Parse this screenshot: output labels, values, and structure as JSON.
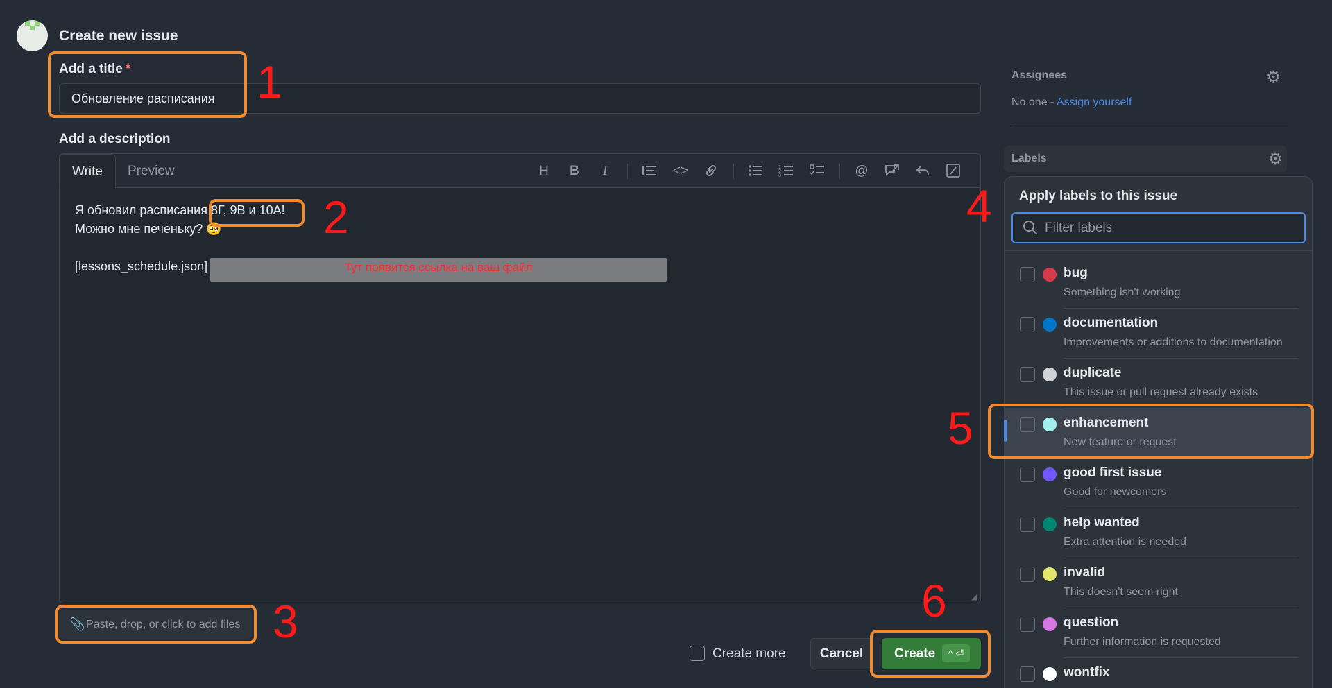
{
  "header": {
    "page_title": "Create new issue"
  },
  "title_field": {
    "label": "Add a title",
    "required_mark": "*",
    "value": "Обновление расписания"
  },
  "description": {
    "label": "Add a description",
    "tabs": {
      "write": "Write",
      "preview": "Preview"
    },
    "toolbar": [
      "heading-icon",
      "bold-icon",
      "italic-icon",
      "quote-icon",
      "code-icon",
      "link-icon",
      "unordered-list-icon",
      "ordered-list-icon",
      "task-list-icon",
      "mention-icon",
      "reference-icon",
      "saved-reply-icon",
      "slash-command-icon"
    ],
    "text": "Я обновил расписания 8Г, 9В и 10А!\nМожно мне печеньку? 🥺\n\n[lessons_schedule.json]",
    "link_placeholder": "Тут появится ссылка на ваш файл"
  },
  "attach": {
    "label": "Paste, drop, or click to add files"
  },
  "actions": {
    "create_more": "Create more",
    "cancel": "Cancel",
    "create": "Create",
    "create_shortcut": "^ ⏎"
  },
  "sidebar": {
    "assignees": {
      "label": "Assignees",
      "none_text": "No one - ",
      "assign_yourself": "Assign yourself"
    },
    "labels": {
      "label": "Labels"
    }
  },
  "labels_panel": {
    "title": "Apply labels to this issue",
    "filter_placeholder": "Filter labels",
    "items": [
      {
        "name": "bug",
        "description": "Something isn't working",
        "color": "#d73a4a"
      },
      {
        "name": "documentation",
        "description": "Improvements or additions to documentation",
        "color": "#0075ca"
      },
      {
        "name": "duplicate",
        "description": "This issue or pull request already exists",
        "color": "#cfd3d7"
      },
      {
        "name": "enhancement",
        "description": "New feature or request",
        "color": "#a2eeef"
      },
      {
        "name": "good first issue",
        "description": "Good for newcomers",
        "color": "#7057ff"
      },
      {
        "name": "help wanted",
        "description": "Extra attention is needed",
        "color": "#008672"
      },
      {
        "name": "invalid",
        "description": "This doesn't seem right",
        "color": "#e4e669"
      },
      {
        "name": "question",
        "description": "Further information is requested",
        "color": "#d876e3"
      },
      {
        "name": "wontfix",
        "description": "",
        "color": "#ffffff"
      }
    ]
  },
  "annotations": [
    "1",
    "2",
    "3",
    "4",
    "5",
    "6"
  ],
  "colors": {
    "accent": "#478be6",
    "primary_button": "#347d39",
    "highlight": "#f28b2f",
    "annotation_text": "#ff1a1a"
  }
}
